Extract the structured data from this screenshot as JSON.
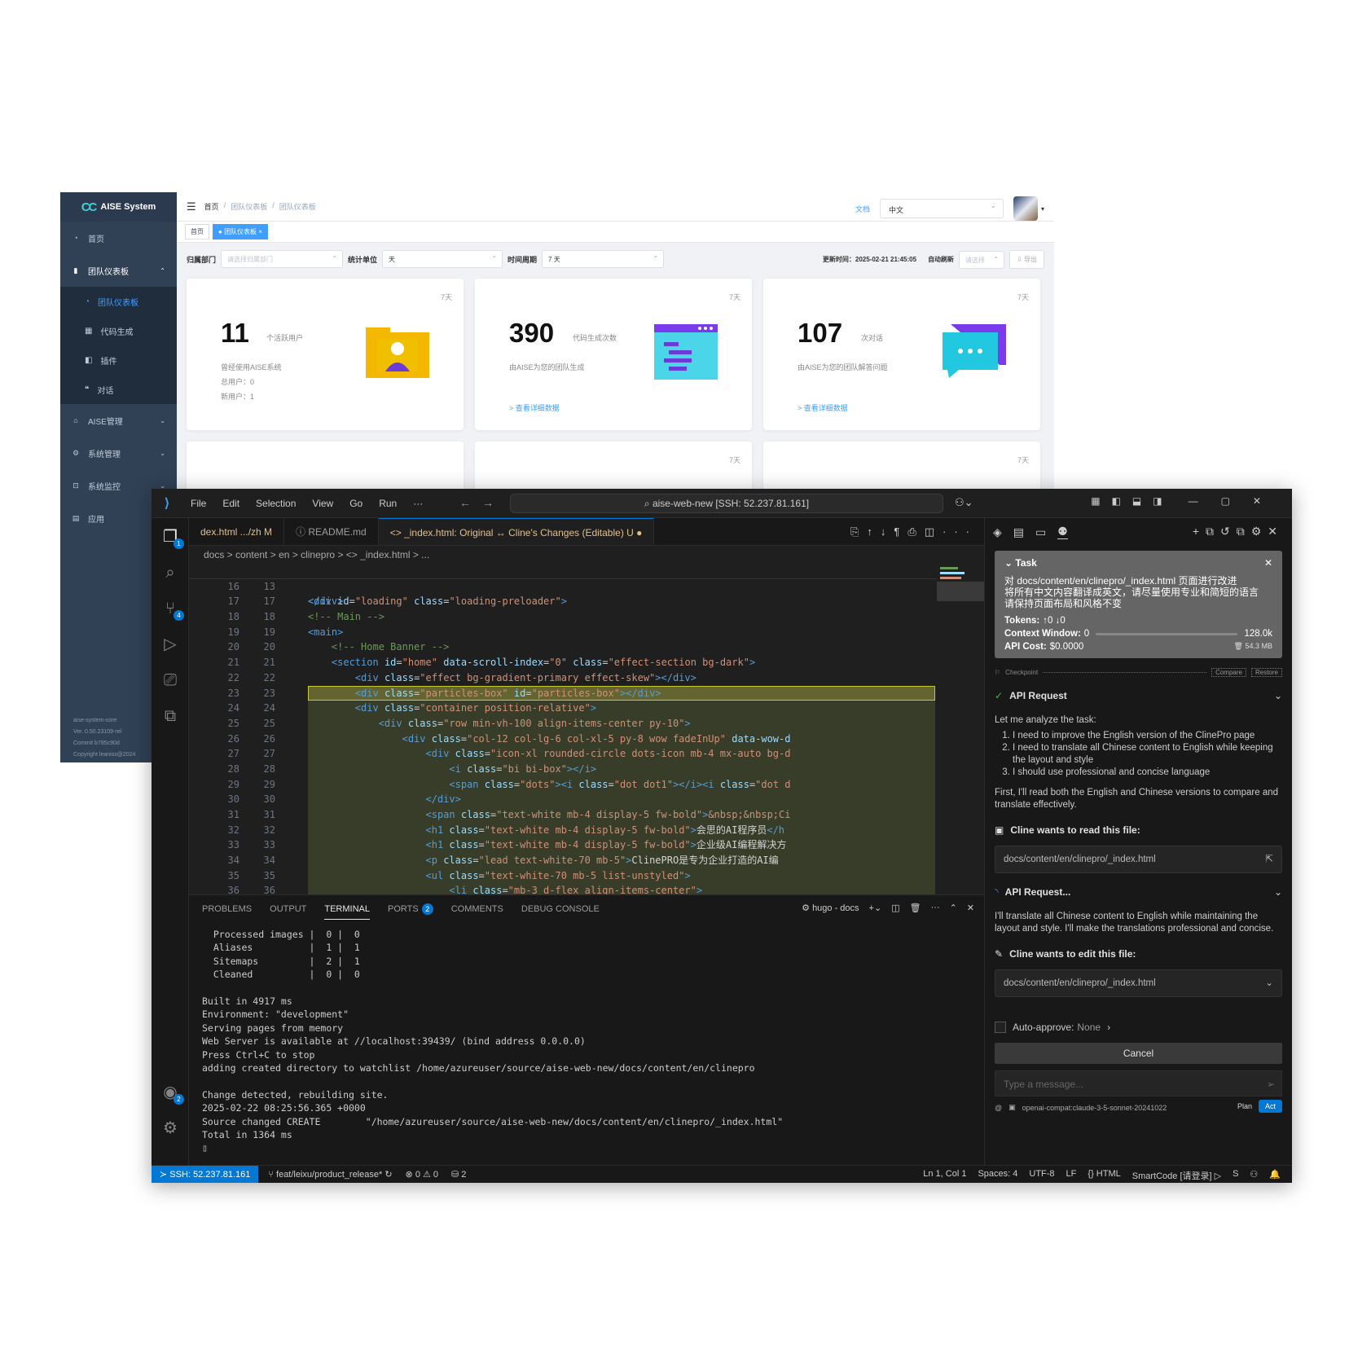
{
  "aise": {
    "logo_mark": "CC",
    "app_name": "AISE System",
    "sidebar": [
      {
        "label": "首页",
        "icon": "dashboard-icon"
      },
      {
        "label": "团队仪表板",
        "icon": "bar-chart-icon",
        "open": true
      },
      {
        "label": "团队仪表板",
        "icon": "dashboard-icon",
        "sub": true,
        "active": true
      },
      {
        "label": "代码生成",
        "icon": "grid-icon",
        "sub": true
      },
      {
        "label": "插件",
        "icon": "plugin-icon",
        "sub": true
      },
      {
        "label": "对话",
        "icon": "chat-icon",
        "sub": true
      },
      {
        "label": "AISE管理",
        "icon": "settings-icon"
      },
      {
        "label": "系统管理",
        "icon": "gear-icon"
      },
      {
        "label": "系统监控",
        "icon": "monitor-icon"
      },
      {
        "label": "应用",
        "icon": "app-icon"
      }
    ],
    "footer": [
      "aise-system-core",
      "Ver. 0.50.23109-rel",
      "Commit b785c90d",
      "Copyright leaniss@2024"
    ],
    "breadcrumb": [
      "首页",
      "团队仪表板",
      "团队仪表板"
    ],
    "docs_link": "文档",
    "language": "中文",
    "tags": [
      "首页",
      "团队仪表板"
    ],
    "filters": {
      "dept_label": "归属部门",
      "dept_placeholder": "请选择归属部门",
      "unit_label": "统计单位",
      "unit_value": "天",
      "period_label": "时间周期",
      "period_value": "7 天",
      "updated": "更新时间：2025-02-21 21:45:05",
      "auto_refresh_label": "自动刷新",
      "auto_refresh_placeholder": "请选择",
      "export": "⇩ 导出"
    },
    "cards": [
      {
        "period": "7天",
        "value": "11",
        "unit": "个活跃用户",
        "desc": [
          "曾经使用AISE系统",
          "总用户：0",
          "新用户：1"
        ],
        "more": ""
      },
      {
        "period": "7天",
        "value": "390",
        "unit": "代码生成次数",
        "desc": [
          "由AISE为您的团队生成"
        ],
        "more": "> 查看详细数据"
      },
      {
        "period": "7天",
        "value": "107",
        "unit": "次对话",
        "desc": [
          "由AISE为您的团队解答问题"
        ],
        "more": "> 查看详细数据"
      }
    ],
    "cards_row2": [
      "",
      "7天",
      "7天"
    ]
  },
  "vscode": {
    "menu": [
      "File",
      "Edit",
      "Selection",
      "View",
      "Go",
      "Run",
      "···"
    ],
    "command_center": "aise-web-new [SSH: 52.237.81.161]",
    "tabs": [
      {
        "label": "dex.html .../zh M",
        "state": "modified"
      },
      {
        "label": "ⓘ README.md",
        "state": "normal"
      },
      {
        "label": "<> _index.html: Original ↔ Cline's Changes (Editable) U ●",
        "state": "active"
      }
    ],
    "breadcrumbs": "docs > content > en > clinepro > <> _index.html > ...",
    "sticky_line": {
      "ln": "13",
      "html": "<span class=\"tg\">&lt;div</span> <span class=\"at\">id</span>=<span class=\"st\">\"loading\"</span> <span class=\"at\">class</span>=<span class=\"st\">\"loading-preloader\"</span><span class=\"tg\">&gt;</span>"
    },
    "code_lines": [
      {
        "a": "16",
        "b": "",
        "t": "",
        "d": false
      },
      {
        "a": "17",
        "b": "17",
        "t": "<span class=\"tg\">&lt;/div&gt;</span>",
        "d": false
      },
      {
        "a": "18",
        "b": "18",
        "t": "<span class=\"cm\">&lt;!-- Main --&gt;</span>",
        "d": false
      },
      {
        "a": "19",
        "b": "19",
        "t": "<span class=\"tg\">&lt;main&gt;</span>",
        "d": false
      },
      {
        "a": "20",
        "b": "20",
        "t": "    <span class=\"cm\">&lt;!-- Home Banner --&gt;</span>",
        "d": false
      },
      {
        "a": "21",
        "b": "21",
        "t": "    <span class=\"tg\">&lt;section</span> <span class=\"at\">id</span>=<span class=\"st\">\"home\"</span> <span class=\"at\">data-scroll-index</span>=<span class=\"st\">\"0\"</span> <span class=\"at\">class</span>=<span class=\"st\">\"effect-section bg-dark\"</span><span class=\"tg\">&gt;</span>",
        "d": false
      },
      {
        "a": "22",
        "b": "22",
        "t": "        <span class=\"tg\">&lt;div</span> <span class=\"at\">class</span>=<span class=\"st\">\"effect bg-gradient-primary effect-skew\"</span><span class=\"tg\">&gt;&lt;/div&gt;</span>",
        "d": false
      },
      {
        "a": "23",
        "b": "23",
        "t": "        <span class=\"tg\">&lt;div</span> <span class=\"at\">class</span>=<span class=\"st\">\"particles-box\"</span> <span class=\"at\">id</span>=<span class=\"st\">\"particles-box\"</span><span class=\"tg\">&gt;&lt;/div&gt;</span>",
        "d": "sel"
      },
      {
        "a": "24",
        "b": "24",
        "t": "        <span class=\"tg\">&lt;div</span> <span class=\"at\">class</span>=<span class=\"st\">\"container position-relative\"</span><span class=\"tg\">&gt;</span>",
        "d": true
      },
      {
        "a": "25",
        "b": "25",
        "t": "            <span class=\"tg\">&lt;div</span> <span class=\"at\">class</span>=<span class=\"st\">\"row min-vh-100 align-items-center py-10\"</span><span class=\"tg\">&gt;</span>",
        "d": true
      },
      {
        "a": "26",
        "b": "26",
        "t": "                <span class=\"tg\">&lt;div</span> <span class=\"at\">class</span>=<span class=\"st\">\"col-12 col-lg-6 col-xl-5 py-8 wow fadeInUp\"</span> <span class=\"at\">data-wow-d</span>",
        "d": true
      },
      {
        "a": "27",
        "b": "27",
        "t": "                    <span class=\"tg\">&lt;div</span> <span class=\"at\">class</span>=<span class=\"st\">\"icon-xl rounded-circle dots-icon mb-4 mx-auto bg-d</span>",
        "d": true
      },
      {
        "a": "28",
        "b": "28",
        "t": "                        <span class=\"tg\">&lt;i</span> <span class=\"at\">class</span>=<span class=\"st\">\"bi bi-box\"</span><span class=\"tg\">&gt;&lt;/i&gt;</span>",
        "d": true
      },
      {
        "a": "29",
        "b": "29",
        "t": "                        <span class=\"tg\">&lt;span</span> <span class=\"at\">class</span>=<span class=\"st\">\"dots\"</span><span class=\"tg\">&gt;&lt;i</span> <span class=\"at\">class</span>=<span class=\"st\">\"dot dot1\"</span><span class=\"tg\">&gt;&lt;/i&gt;&lt;i</span> <span class=\"at\">class</span>=<span class=\"st\">\"dot d</span>",
        "d": true
      },
      {
        "a": "30",
        "b": "30",
        "t": "                    <span class=\"tg\">&lt;/div&gt;</span>",
        "d": true
      },
      {
        "a": "31",
        "b": "31",
        "t": "                    <span class=\"tg\">&lt;span</span> <span class=\"at\">class</span>=<span class=\"st\">\"text-white mb-4 display-5 fw-bold\"</span><span class=\"tg\">&gt;</span><span class=\"st\">&amp;nbsp;&amp;nbsp;Ci</span>",
        "d": true
      },
      {
        "a": "32",
        "b": "32",
        "t": "                    <span class=\"tg\">&lt;h1</span> <span class=\"at\">class</span>=<span class=\"st\">\"text-white mb-4 display-5 fw-bold\"</span><span class=\"tg\">&gt;</span><span class=\"tx\">会思的AI程序员</span><span class=\"tg\">&lt;/h</span>",
        "d": true
      },
      {
        "a": "33",
        "b": "33",
        "t": "                    <span class=\"tg\">&lt;h1</span> <span class=\"at\">class</span>=<span class=\"st\">\"text-white mb-4 display-5 fw-bold\"</span><span class=\"tg\">&gt;</span><span class=\"tx\">企业级AI编程解决方</span>",
        "d": true
      },
      {
        "a": "34",
        "b": "34",
        "t": "                    <span class=\"tg\">&lt;p</span> <span class=\"at\">class</span>=<span class=\"st\">\"lead text-white-70 mb-5\"</span><span class=\"tg\">&gt;</span><span class=\"tx\">ClinePRO是专为企业打造的AI编</span>",
        "d": true
      },
      {
        "a": "35",
        "b": "35",
        "t": "                    <span class=\"tg\">&lt;ul</span> <span class=\"at\">class</span>=<span class=\"st\">\"text-white-70 mb-5 list-unstyled\"</span><span class=\"tg\">&gt;</span>",
        "d": true
      },
      {
        "a": "36",
        "b": "36",
        "t": "                        <span class=\"tg\">&lt;li</span> <span class=\"at\">class</span>=<span class=\"st\">\"mb-3 d-flex align-items-center\"</span><span class=\"tg\">&gt;</span>",
        "d": true
      },
      {
        "a": "37",
        "b": "37",
        "t": "                            <span class=\"tg\">&lt;i</span> <span class=\"at\">class</span>=<span class=\"st\">\"bi bi-check-circle-fill text-success me-2\"</span><span class=\"tg\">&gt;&lt;</span>",
        "d": true
      }
    ],
    "panel_tabs": [
      "PROBLEMS",
      "OUTPUT",
      "TERMINAL",
      "PORTS",
      "COMMENTS",
      "DEBUG CONSOLE"
    ],
    "ports_count": "2",
    "terminal_name": "hugo - docs",
    "terminal_lines": [
      "  Processed images |  0 |  0",
      "  Aliases          |  1 |  1",
      "  Sitemaps         |  2 |  1",
      "  Cleaned          |  0 |  0",
      "",
      "Built in 4917 ms",
      "Environment: \"development\"",
      "Serving pages from memory",
      "Web Server is available at //localhost:39439/ (bind address 0.0.0.0)",
      "Press Ctrl+C to stop",
      "adding created directory to watchlist /home/azureuser/source/aise-web-new/docs/content/en/clinepro",
      "",
      "Change detected, rebuilding site.",
      "2025-02-22 08:25:56.365 +0000",
      "Source changed CREATE        \"/home/azureuser/source/aise-web-new/docs/content/en/clinepro/_index.html\"",
      "Total in 1364 ms",
      "▯"
    ],
    "cline": {
      "task_title": "Task",
      "task_text": [
        "对 docs/content/en/clinepro/_index.html 页面进行改进",
        "将所有中文内容翻译成英文，请尽量使用专业和简短的语言",
        "请保持页面布局和风格不变"
      ],
      "tokens_label": "Tokens:",
      "tokens_value": "↑0 ↓0",
      "context_label": "Context Window:",
      "context_value": "0",
      "context_max": "128.0k",
      "cost_label": "API Cost:",
      "cost_value": "$0.0000",
      "size": "54.3 MB",
      "checkpoint": "Checkpoint",
      "compare": "Compare",
      "restore": "Restore",
      "api_request": "API Request",
      "analyze": "Let me analyze the task:",
      "steps": [
        "I need to improve the English version of the ClinePro page",
        "I need to translate all Chinese content to English while keeping the layout and style",
        "I should use professional and concise language"
      ],
      "first": "First, I'll read both the English and Chinese versions to compare and translate effectively.",
      "read_label": "Cline wants to read this file:",
      "file": "docs/content/en/clinepro/_index.html",
      "api_request2": "API Request...",
      "translate": "I'll translate all Chinese content to English while maintaining the layout and style. I'll make the translations professional and concise.",
      "edit_label": "Cline wants to edit this file:",
      "auto_approve": "Auto-approve:",
      "auto_value": "None",
      "cancel": "Cancel",
      "placeholder": "Type a message...",
      "model": "openai-compat:claude-3-5-sonnet-20241022",
      "plan": "Plan",
      "act": "Act"
    },
    "status": {
      "remote": "≻ SSH: 52.237.81.161",
      "branch": "feat/leixu/product_release*",
      "problems": "⊗ 0 ⚠ 0",
      "ports": "⛁ 2",
      "pos": "Ln 1, Col 1",
      "spaces": "Spaces: 4",
      "enc": "UTF-8",
      "eol": "LF",
      "lang": "{} HTML",
      "smart": "SmartCode [请登录]",
      "s": "S"
    }
  }
}
